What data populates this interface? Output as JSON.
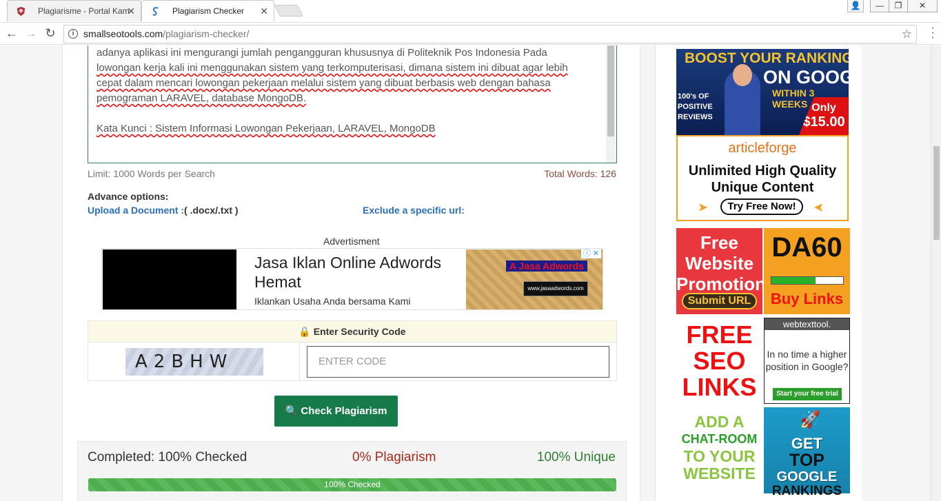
{
  "browser": {
    "tabs": [
      {
        "title": "Plagiarisme - Portal Kam"
      },
      {
        "title": "Plagiarism Checker"
      }
    ],
    "url_host": "smallseotools.com",
    "url_path": "/plagiarism-checker/"
  },
  "editor": {
    "line1_a": "adanya aplikasi ini mengurangi jumlah pengangguran khususnya di Politeknik Pos Indonesia Pada",
    "line2_a": "lowongan kerja kali ini menggunakan sistem yang terkomputerisasi, dimana sistem ini dibuat agar lebih",
    "line3_a": "cepat dalam mencari lowongan pekerjaan melalui sistem yang dibuat berbasis web dengan bahasa",
    "line4_a": "pemograman LARAVEL, database MongoDB.",
    "keywords": "Kata Kunci : Sistem Informasi Lowongan Pekerjaan,  LARAVEL, MongoDB",
    "limit_text": "Limit: 1000 Words per Search",
    "total_text": "Total Words: 126"
  },
  "options": {
    "advance_label": "Advance options:",
    "upload_label": "Upload a Document :",
    "upload_formats": "( .docx/.txt )",
    "exclude_label": "Exclude a specific url:"
  },
  "ad": {
    "label": "Advertisment",
    "title": "Jasa Iklan Online Adwords Hemat",
    "subtitle": "Iklankan Usaha Anda bersama Kami",
    "logo_text": "A Jasa Adwords",
    "url_text": "www.jasaadwords.com",
    "choices": "ⓘ ✕"
  },
  "security": {
    "heading": "Enter Security Code",
    "captcha_text": "A2BHW",
    "code_placeholder": "ENTER CODE"
  },
  "check_button": "Check Plagiarism",
  "results": {
    "completed": "Completed: 100% Checked",
    "plagiarism": "0% Plagiarism",
    "unique": "100% Unique",
    "progress_label": "100% Checked",
    "progress_fraction": 1.0
  },
  "sidebar": {
    "b1": {
      "l1": "BOOST YOUR RANKING",
      "l2": "ON GOOGLE",
      "l3": "WITHIN 3 WEEKS",
      "l4": "100's OF POSITIVE REVIEWS",
      "price_a": "Only",
      "price_b": "$15.00"
    },
    "b2": {
      "brand": "articleforge",
      "head": "Unlimited High Quality Unique Content",
      "cta": "Try Free Now!"
    },
    "b3": {
      "head": "Free Website Promotion",
      "cta": "Submit URL"
    },
    "b4": {
      "head": "DA60",
      "cta": "Buy Links"
    },
    "b5": {
      "head": "FREE SEO LINKS"
    },
    "b6": {
      "brand": "webtexttool.",
      "body": "In no time a higher position in Google?",
      "cta": "Start your free trial"
    },
    "b7": {
      "l1": "ADD A",
      "l2": "CHAT-ROOM",
      "l3": "TO YOUR",
      "l4": "WEBSITE"
    },
    "b8": {
      "l1": "GET",
      "l2": "TOP",
      "l3": "GOOGLE",
      "l4": "RANKINGS"
    }
  }
}
